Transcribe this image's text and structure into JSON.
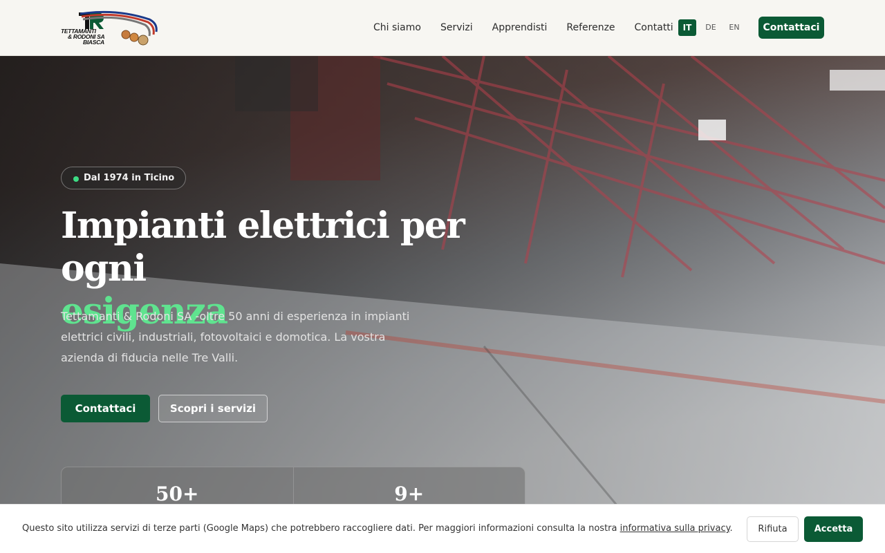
{
  "header": {
    "logo": {
      "line1": "TETTAMANTI",
      "line2": "& RODONI SA",
      "line3": "BIASCA"
    },
    "nav": [
      "Chi siamo",
      "Servizi",
      "Apprendisti",
      "Referenze",
      "Contatti"
    ],
    "languages": [
      "IT",
      "DE",
      "EN"
    ],
    "active_language": "IT",
    "cta_label": "Contattaci"
  },
  "hero": {
    "badge": "Dal 1974 in Ticino",
    "title_line1": "Impianti elettrici per ogni",
    "title_accent": "esigenza",
    "lead": "Tettamanti & Rodoni SA -oltre 50 anni di esperienza in impianti elettrici civili, industriali, fotovoltaici e domotica. La vostra azienda di fiducia nelle Tre Valli.",
    "primary_button": "Contattaci",
    "secondary_button": "Scopri i servizi",
    "stats": [
      "50+",
      "9+"
    ]
  },
  "cookie": {
    "text": "Questo sito utilizza servizi di terze parti (Google Maps) che potrebbero raccogliere dati. Per maggiori informazioni consulta la nostra ",
    "link": "informativa sulla privacy",
    "suffix": ".",
    "reject": "Rifiuta",
    "accept": "Accetta"
  },
  "colors": {
    "brand_green": "#0b5a35",
    "accent_green": "#5fe38f",
    "dot_green": "#3ddc84"
  }
}
